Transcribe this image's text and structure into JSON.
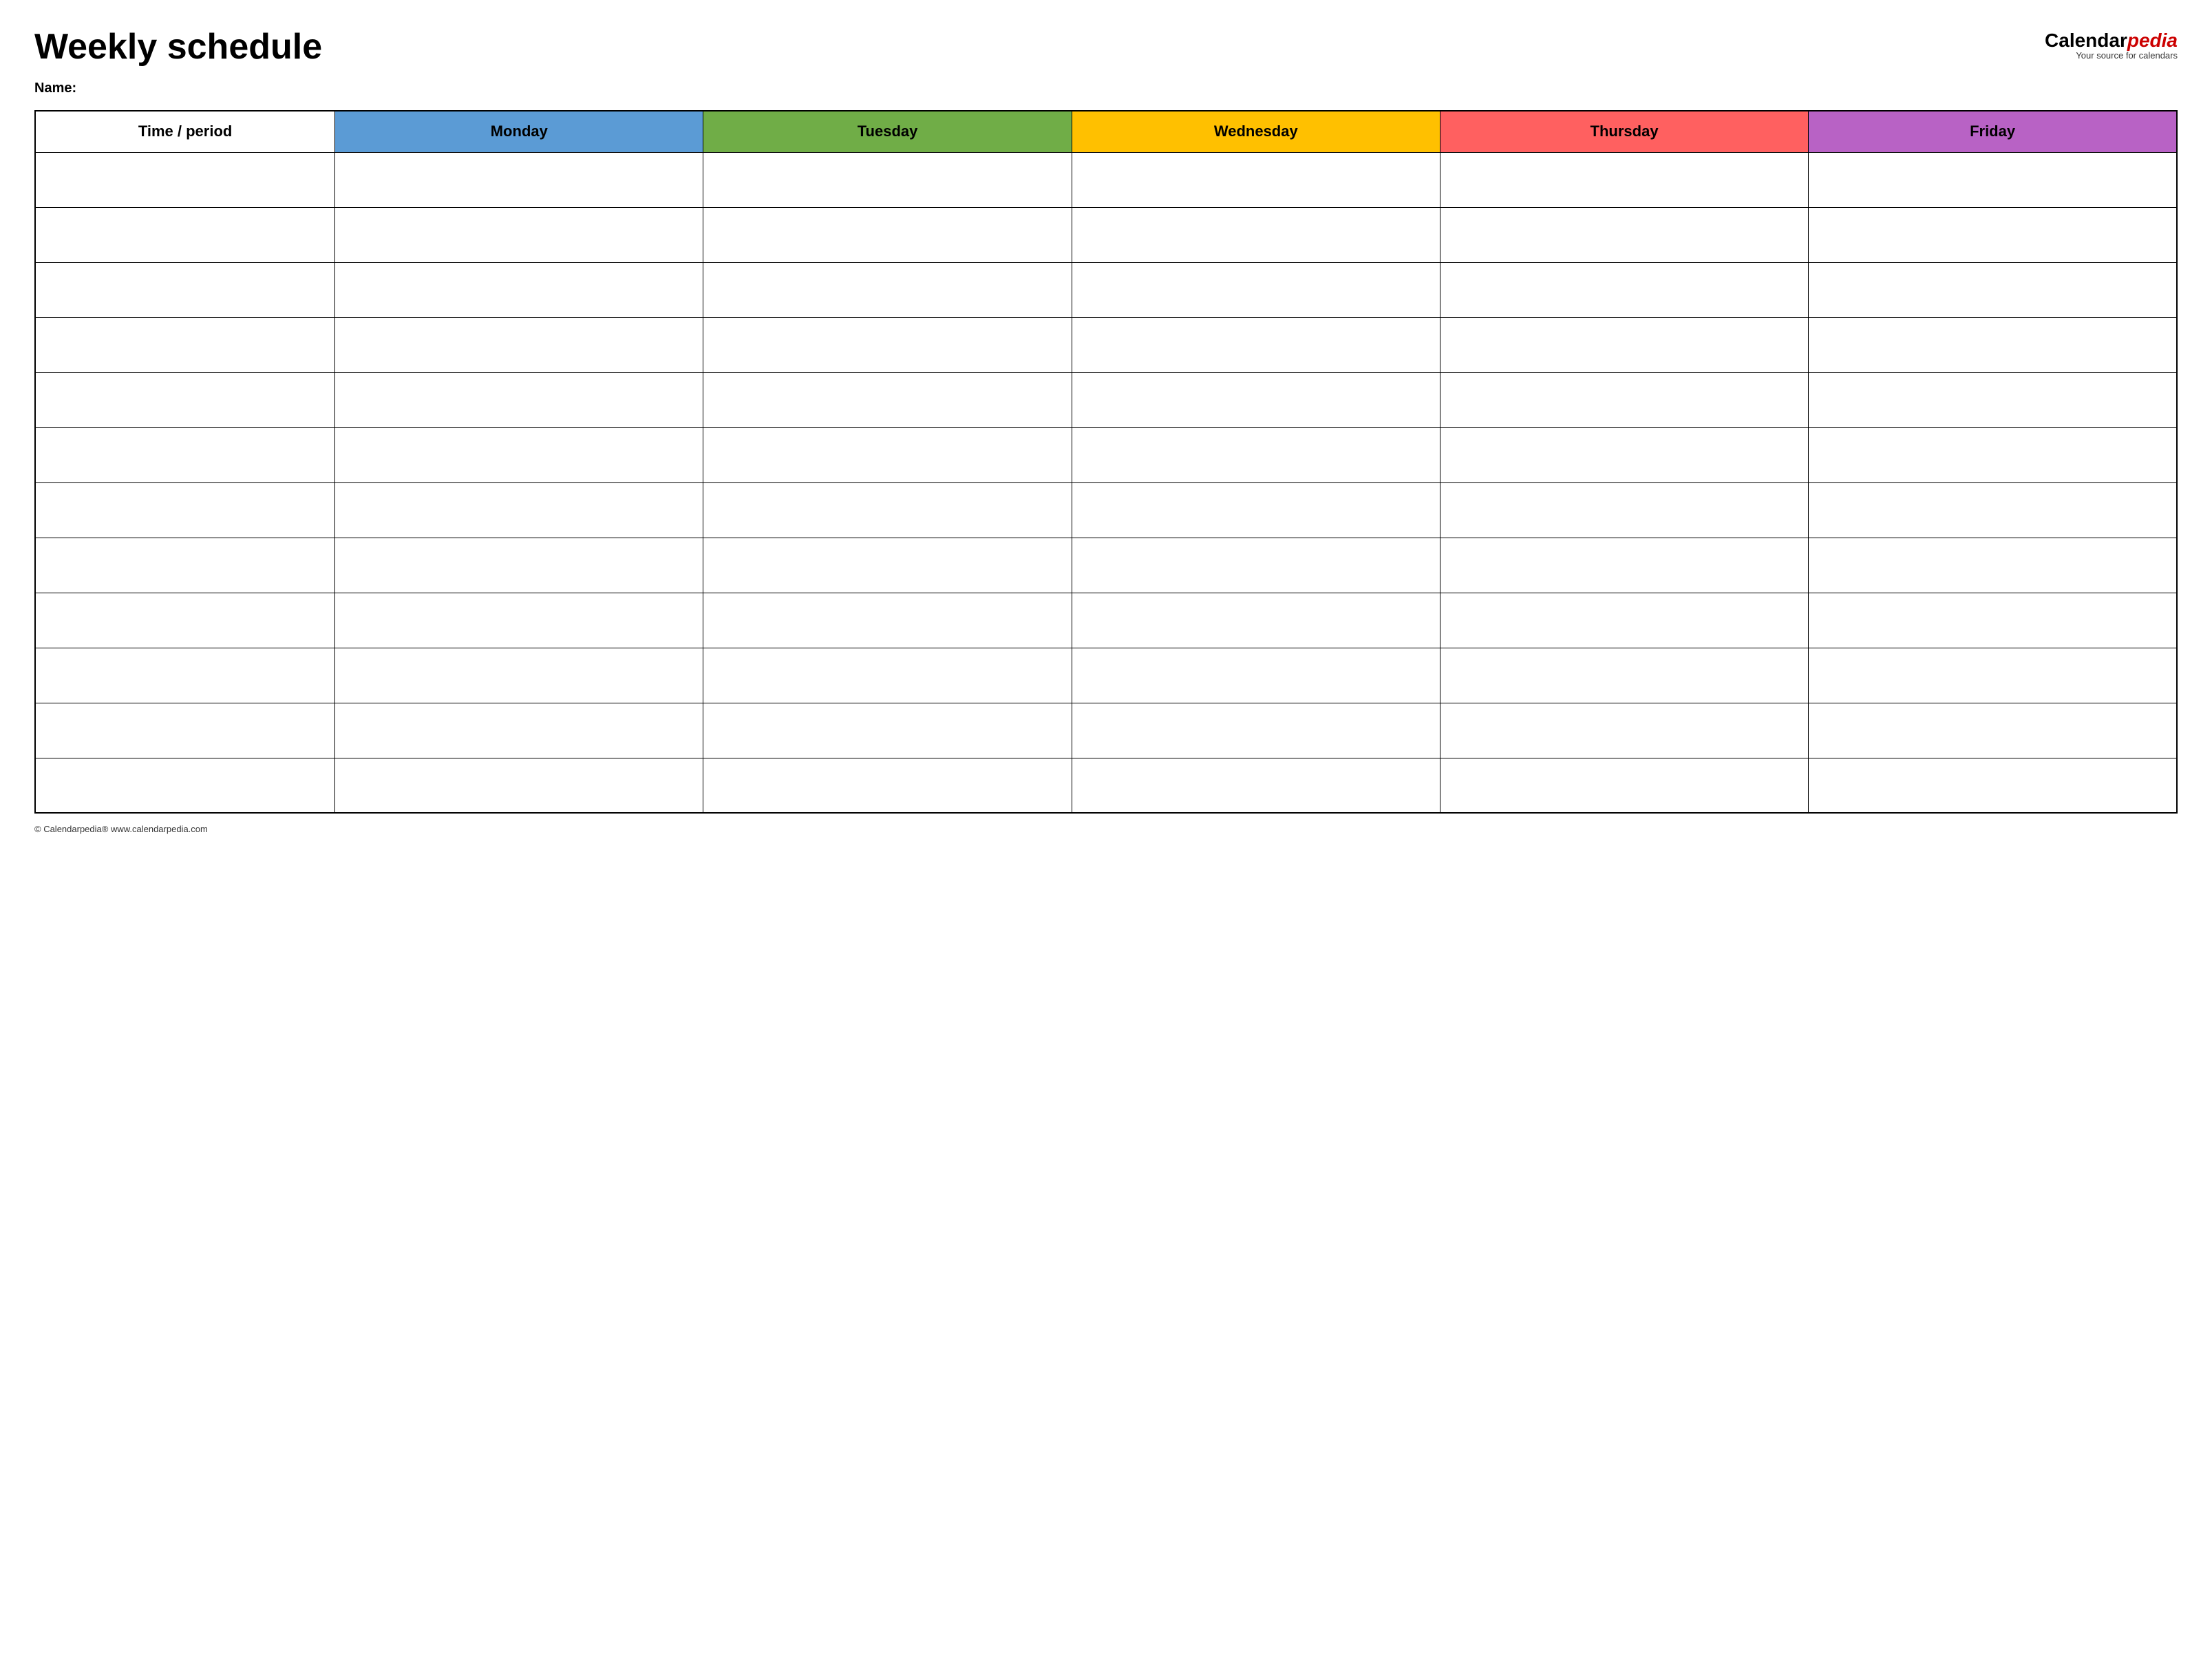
{
  "header": {
    "title": "Weekly schedule",
    "logo": {
      "brand_part1": "Calendar",
      "brand_part2": "pedia",
      "tagline": "Your source for calendars"
    }
  },
  "name_label": "Name:",
  "table": {
    "columns": [
      {
        "id": "time",
        "label": "Time / period",
        "color": "#ffffff",
        "text_color": "#000000"
      },
      {
        "id": "monday",
        "label": "Monday",
        "color": "#5b9bd5",
        "text_color": "#000000"
      },
      {
        "id": "tuesday",
        "label": "Tuesday",
        "color": "#70ad47",
        "text_color": "#000000"
      },
      {
        "id": "wednesday",
        "label": "Wednesday",
        "color": "#ffc000",
        "text_color": "#000000"
      },
      {
        "id": "thursday",
        "label": "Thursday",
        "color": "#ff6060",
        "text_color": "#000000"
      },
      {
        "id": "friday",
        "label": "Friday",
        "color": "#b862c5",
        "text_color": "#000000"
      }
    ],
    "row_count": 12
  },
  "footer": {
    "copyright": "© Calendarpedia®  www.calendarpedia.com"
  }
}
